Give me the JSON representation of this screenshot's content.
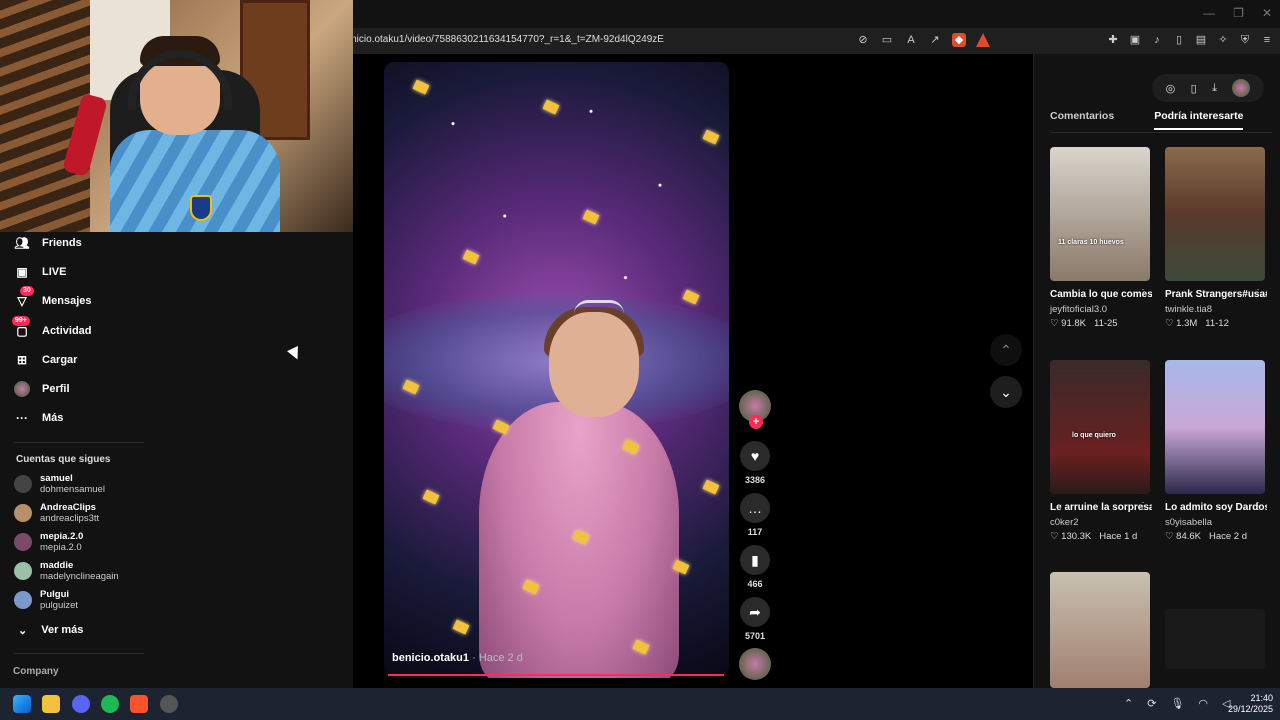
{
  "browser": {
    "url": "benicio.otaku1/video/7588630211634154770?_r=1&_t=ZM-92d4lQ249zE"
  },
  "sidebar": {
    "items": [
      {
        "label": "Friends",
        "icon": "friends-icon"
      },
      {
        "label": "LIVE",
        "icon": "live-icon"
      },
      {
        "label": "Mensajes",
        "icon": "messages-icon",
        "badge": "30"
      },
      {
        "label": "Actividad",
        "icon": "activity-icon",
        "badge": "99+"
      },
      {
        "label": "Cargar",
        "icon": "upload-icon"
      },
      {
        "label": "Perfil",
        "icon": "profile-avatar"
      },
      {
        "label": "Más",
        "icon": "more-icon"
      }
    ],
    "follows_title": "Cuentas que sigues",
    "follows": [
      {
        "name": "samuel",
        "handle": "dohmensamuel",
        "color": "#444444"
      },
      {
        "name": "AndreaClips",
        "handle": "andreaclips3tt",
        "color": "#b8906a"
      },
      {
        "name": "mepia.2.0",
        "handle": "mepia.2.0",
        "color": "#7a4a6a"
      },
      {
        "name": "maddie",
        "handle": "madelynclineagain",
        "color": "#9ac0a8"
      },
      {
        "name": "Pulgui",
        "handle": "pulguizet",
        "color": "#7a9acc"
      }
    ],
    "see_more": "Ver más",
    "company": "Company"
  },
  "video": {
    "author": "benicio.otaku1",
    "ago": "· Hace 2 d",
    "likes": "3386",
    "comments": "117",
    "saves": "466",
    "shares": "5701",
    "progress": 1.0
  },
  "rightpane": {
    "tabs": [
      "Comentarios",
      "Podría interesarte"
    ],
    "active_tab": "Podría interesarte",
    "cards": [
      {
        "title": "Cambia lo que comes, no tu vid...",
        "author": "jeyfitoficial3.0",
        "likes": "91.8K",
        "date": "11-25",
        "thumb_text": "11 claras   10 huevos"
      },
      {
        "title": "Prank Strangers#usa#f...",
        "author": "twinkle.tia8",
        "likes": "1.3M",
        "date": "11-12",
        "thumb_text": ""
      },
      {
        "title": "Le arruine la sorpresa... #coke...",
        "author": "c0ker2",
        "likes": "130.3K",
        "date": "Hace 1 d",
        "thumb_text": "lo que quiero"
      },
      {
        "title": "Lo admito soy Dardosholiccc,...",
        "author": "s0yisabella",
        "likes": "84.6K",
        "date": "Hace 2 d",
        "thumb_text": ""
      }
    ]
  },
  "taskbar": {
    "time": "21:40",
    "date": "29/12/2025"
  },
  "colors": {
    "accent": "#fe2c55",
    "confetti": "#f2c23a"
  }
}
